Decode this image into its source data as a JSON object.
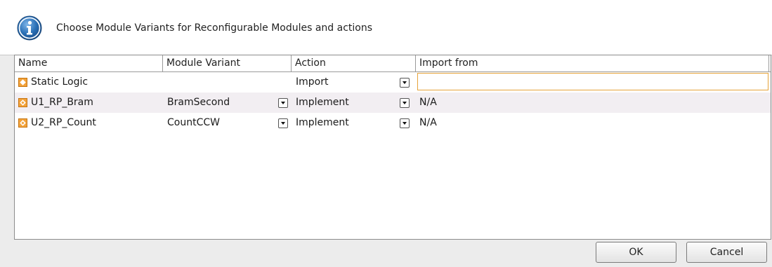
{
  "header": {
    "message": "Choose Module Variants for Reconfigurable Modules and actions",
    "icon": "info-icon"
  },
  "table": {
    "columns": [
      "Name",
      "Module Variant",
      "Action",
      "Import from"
    ],
    "rows": [
      {
        "name": "Static Logic",
        "icon": "static-logic-icon",
        "module_variant": "",
        "action": "Import",
        "import_from": ""
      },
      {
        "name": "U1_RP_Bram",
        "icon": "reconfig-module-icon",
        "module_variant": "BramSecond",
        "action": "Implement",
        "import_from": "N/A"
      },
      {
        "name": "U2_RP_Count",
        "icon": "reconfig-module-icon",
        "module_variant": "CountCCW",
        "action": "Implement",
        "import_from": "N/A"
      }
    ]
  },
  "buttons": {
    "ok": "OK",
    "cancel": "Cancel"
  },
  "colors": {
    "accent": "#2a6fb5",
    "module_icon": "#f2a23a",
    "focus_border": "#e6a33a",
    "alt_row": "#f2eef2"
  }
}
